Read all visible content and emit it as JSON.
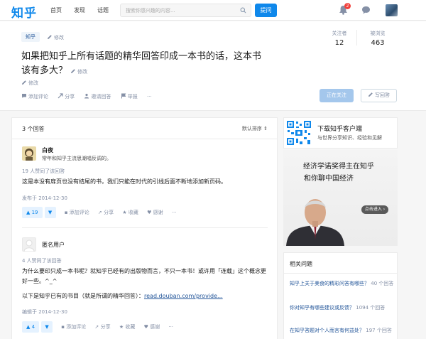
{
  "nav": {
    "logo": "知乎",
    "items": [
      "首页",
      "发现",
      "话题"
    ],
    "search_placeholder": "搜索你感兴趣的内容...",
    "ask_label": "提问",
    "notification_count": "2"
  },
  "question": {
    "topic": "知乎",
    "edit_label": "修改",
    "title": "如果把知乎上所有话题的精华回答印成一本书的话，这本书该有多大？",
    "followers_label": "关注者",
    "followers": "12",
    "views_label": "被浏览",
    "views": "463",
    "actions": [
      "添加评论",
      "分享",
      "邀请回答",
      "举报",
      "···"
    ],
    "follow_btn": "正在关注",
    "answer_btn": "写回答"
  },
  "answers_header": {
    "count": "3 个回答",
    "sort": "默认排序"
  },
  "answers": [
    {
      "author": "白夜",
      "bio": "常年和知乎主流思潮唱反调的。",
      "votes_line": "19 人赞同了该回答",
      "body": "这是本没有扉页也没有结尾的书，我们只能在时代的引线后面不断地添加新页码。",
      "date": "发布于 2014-12-30",
      "vote_count": "▲ 19",
      "actions": [
        "添加评论",
        "分享",
        "收藏",
        "感谢",
        "···"
      ]
    },
    {
      "author": "匿名用户",
      "votes_line": "4 人赞同了该回答",
      "body1": "为什么要印只成一本书呢？就知乎已经有的出版物而言，不只一本书！或许用「连载」这个概念更好一些。^_^",
      "body2_prefix": "以下是知乎已有的书目（就是所谓的精华回答）：",
      "body2_link": "read.douban.com/provide...",
      "date": "编辑于 2014-12-30",
      "vote_count": "▲ 4",
      "actions": [
        "添加评论",
        "分享",
        "收藏",
        "感谢",
        "···"
      ]
    }
  ],
  "sidebar": {
    "app_title": "下载知乎客户端",
    "app_sub": "与世界分享知识、经验和见解",
    "ad_line1": "经济学诺奖得主在知乎",
    "ad_line2": "和你聊中国经济",
    "ad_btn": "点击进入 ›",
    "related_title": "相关问题",
    "related": [
      {
        "q": "知乎上关于美食的精彩问答有哪些？",
        "c": "40 个回答"
      },
      {
        "q": "你对知乎有哪些建议或反馈？",
        "c": "1094 个回答"
      },
      {
        "q": "在知乎答题对个人而言有何益处？",
        "c": "197 个回答"
      }
    ]
  }
}
